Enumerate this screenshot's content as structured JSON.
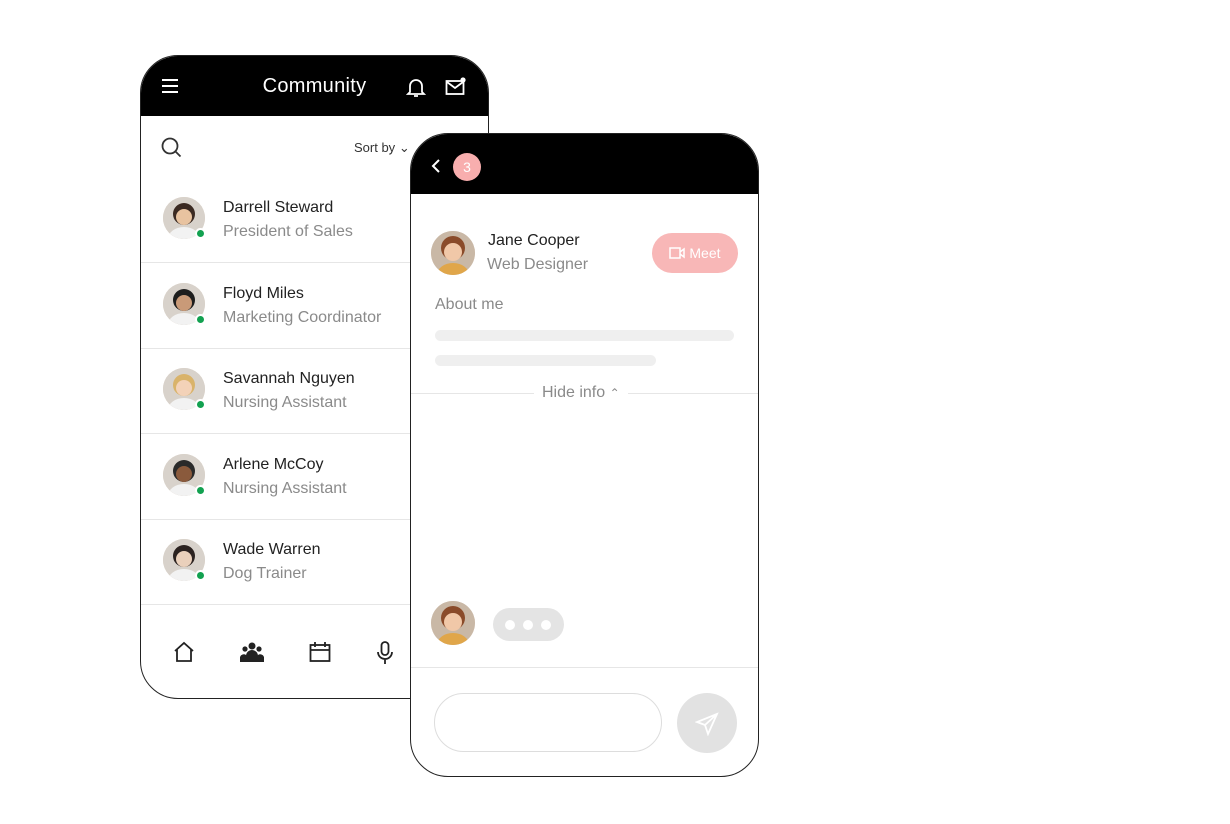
{
  "community": {
    "title": "Community",
    "sort_label": "Sort by",
    "icons": [
      "menu-icon",
      "bell-icon",
      "mail-icon",
      "search-icon",
      "chevron-down-icon"
    ],
    "online_color": "#12a150",
    "members": [
      {
        "name": "Darrell Steward",
        "role": "President of Sales",
        "online": true
      },
      {
        "name": "Floyd Miles",
        "role": "Marketing Coordinator",
        "online": true
      },
      {
        "name": "Savannah Nguyen",
        "role": "Nursing Assistant",
        "online": true
      },
      {
        "name": "Arlene McCoy",
        "role": "Nursing Assistant",
        "online": true
      },
      {
        "name": "Wade Warren",
        "role": "Dog Trainer",
        "online": true
      }
    ],
    "nav": [
      "home-icon",
      "people-icon",
      "calendar-icon",
      "microphone-icon"
    ]
  },
  "chat": {
    "badge_count": "3",
    "badge_color": "#f8aeae",
    "contact": {
      "name": "Jane Cooper",
      "role": "Web Designer"
    },
    "meet_label": "Meet",
    "about_label": "About me",
    "hide_info_label": "Hide info",
    "message_placeholder": ""
  }
}
